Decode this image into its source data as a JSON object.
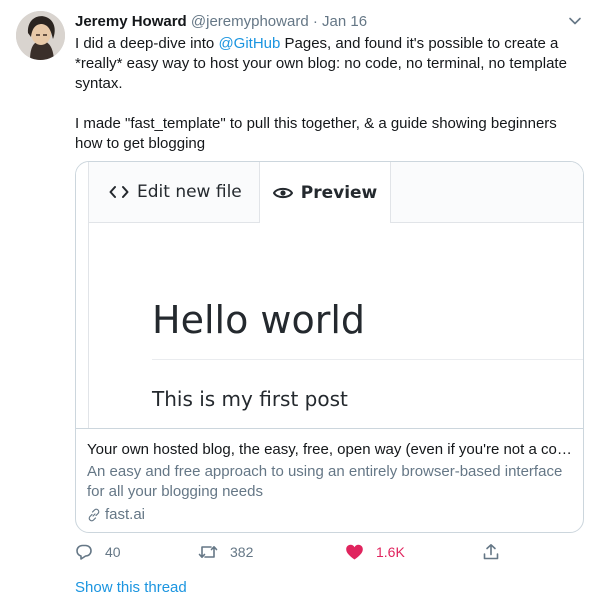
{
  "tweet": {
    "author_name": "Jeremy Howard",
    "author_handle": "@jeremyphoward",
    "separator": "·",
    "date": "Jan 16",
    "text_part1": "I did a deep-dive into ",
    "mention": "@GitHub",
    "text_part2": " Pages, and found it's possible to create a *really* easy way to host your own blog: no code, no terminal, no template syntax.\n\nI made \"fast_template\" to pull this together, & a guide showing beginners how to get blogging"
  },
  "card": {
    "image": {
      "tab_edit_label": "Edit new file",
      "tab_preview_label": "Preview",
      "heading": "Hello world",
      "paragraph": "This is my first post"
    },
    "title": "Your own hosted blog, the easy, free, open way (even if you're not a com...",
    "description": "An easy and free approach to using an entirely browser-based interface for all your blogging needs",
    "domain": "fast.ai"
  },
  "actions": {
    "reply_count": "40",
    "retweet_count": "382",
    "like_count": "1.6K"
  },
  "show_thread_label": "Show this thread",
  "icons": {
    "caret": "chevron-down-icon",
    "reply": "reply-icon",
    "retweet": "retweet-icon",
    "like": "heart-icon",
    "share": "share-icon",
    "link": "link-icon",
    "code": "code-icon",
    "eye": "eye-icon"
  },
  "colors": {
    "link_blue": "#1b95e0",
    "like_red": "#e0245e",
    "muted": "#657786"
  }
}
